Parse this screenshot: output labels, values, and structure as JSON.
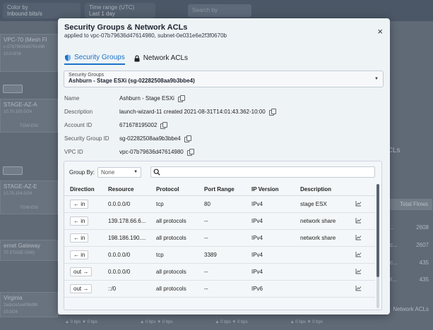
{
  "background": {
    "top": {
      "color_by_label": "Color by",
      "color_by_value": "Inbound bits/s",
      "time_range_label": "Time range (UTC)",
      "time_range_value": "Last 1 day",
      "search_placeholder": "Search by"
    },
    "left_nodes": [
      {
        "title": "VPC-70 (Mesh Fl",
        "sub": "c-07b79636d4761498",
        "sub2": "10.0.0/16"
      },
      {
        "title": "STAGE-AZ-A",
        "sub": "10.70.100.0/24",
        "sub2": "TGW-ENI"
      },
      {
        "title": "STAGE-AZ-E",
        "sub": "10.70.104.0/24",
        "sub2": "TGW-ENI"
      },
      {
        "title": "ernet Gateway",
        "sub": "70 STAGE IGW)",
        "sub2": ""
      },
      {
        "title": "Virginia",
        "sub": "2ada1e1eef0bd8b",
        "sub2": "10.0/24"
      }
    ],
    "right": {
      "total_flows_label": "Total Flows",
      "values": [
        "2608",
        "2607",
        "435",
        "435"
      ],
      "partial_labels": [
        "0/...",
        "blic...",
        "blic...",
        "60/..."
      ],
      "acls_fragment": "ACLs",
      "network_acls_fragment": "Network ACLs"
    },
    "bottom_stats": [
      "▲ 0 bps ▼ 0 bps",
      "▲ 0 bps ▼ 0 bps",
      "▲ 0 bps ▼ 0 bps",
      "▲ 0 bps ▼ 0 bps"
    ]
  },
  "modal": {
    "title": "Security Groups & Network ACLs",
    "subtitle": "applied to vpc-07b79636d47614980, subnet-0e031e6e2f3f0670b",
    "close": "×",
    "tabs": [
      {
        "label": "Security Groups",
        "icon": "shield-icon",
        "active": true
      },
      {
        "label": "Network ACLs",
        "icon": "lock-icon",
        "active": false
      }
    ],
    "security_group_select": {
      "label": "Security Groups",
      "value": "Ashburn - Stage ESXi (sg-02282508aa9b3bbe4)"
    },
    "info": {
      "name_label": "Name",
      "name_value": "Ashburn - Stage ESXi",
      "description_label": "Description",
      "description_value": "launch-wizard-11 created 2021-08-31T14:01:43.362-10:00",
      "account_label": "Account ID",
      "account_value": "671678195002",
      "sgid_label": "Security Group ID",
      "sgid_value": "sg-02282508aa9b3bbe4",
      "vpc_label": "VPC ID",
      "vpc_value": "vpc-07b79636d47614980"
    },
    "table": {
      "group_by_label": "Group By:",
      "group_by_value": "None",
      "search_placeholder": "",
      "headers": [
        "Direction",
        "Resource",
        "Protocol",
        "Port Range",
        "IP Version",
        "Description"
      ],
      "rows": [
        {
          "direction": "← in",
          "resource": "0.0.0.0/0",
          "protocol": "tcp",
          "port": "80",
          "ipver": "IPv4",
          "desc": "stage ESX"
        },
        {
          "direction": "← in",
          "resource": "139.178.66.6...",
          "protocol": "all protocols",
          "port": "--",
          "ipver": "IPv4",
          "desc": "network share"
        },
        {
          "direction": "← in",
          "resource": "198.186.190....",
          "protocol": "all protocols",
          "port": "--",
          "ipver": "IPv4",
          "desc": "network share"
        },
        {
          "direction": "← in",
          "resource": "0.0.0.0/0",
          "protocol": "tcp",
          "port": "3389",
          "ipver": "IPv4",
          "desc": ""
        },
        {
          "direction": "out →",
          "resource": "0.0.0.0/0",
          "protocol": "all protocols",
          "port": "--",
          "ipver": "IPv4",
          "desc": ""
        },
        {
          "direction": "out →",
          "resource": "::/0",
          "protocol": "all protocols",
          "port": "--",
          "ipver": "IPv6",
          "desc": ""
        }
      ]
    }
  },
  "colors": {
    "accent": "#1a73c9",
    "modal_bg": "#eef3f6",
    "backdrop": "#6f7985"
  }
}
